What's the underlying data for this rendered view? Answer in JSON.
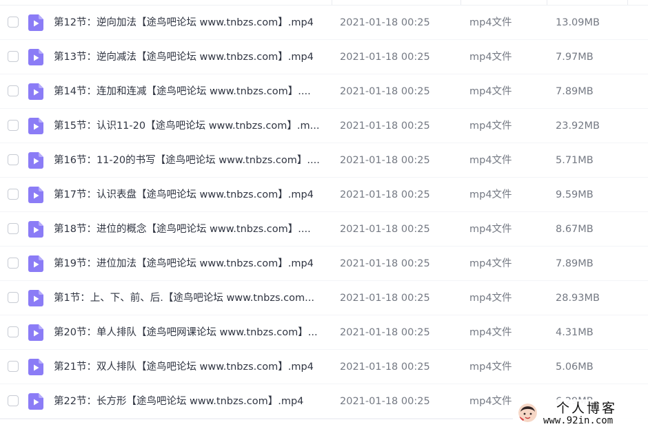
{
  "file_list": {
    "rows": [
      {
        "name": "第12节：逆向加法【途鸟吧论坛 www.tnbzs.com】.mp4",
        "modified": "2021-01-18 00:25",
        "type": "mp4文件",
        "size": "13.09MB"
      },
      {
        "name": "第13节：逆向减法【途鸟吧论坛 www.tnbzs.com】.mp4",
        "modified": "2021-01-18 00:25",
        "type": "mp4文件",
        "size": "7.97MB"
      },
      {
        "name": "第14节：连加和连减【途鸟吧论坛 www.tnbzs.com】....",
        "modified": "2021-01-18 00:25",
        "type": "mp4文件",
        "size": "7.89MB"
      },
      {
        "name": "第15节：认识11-20【途鸟吧论坛 www.tnbzs.com】.m...",
        "modified": "2021-01-18 00:25",
        "type": "mp4文件",
        "size": "23.92MB"
      },
      {
        "name": "第16节：11-20的书写【途鸟吧论坛 www.tnbzs.com】....",
        "modified": "2021-01-18 00:25",
        "type": "mp4文件",
        "size": "5.71MB"
      },
      {
        "name": "第17节：认识表盘【途鸟吧论坛 www.tnbzs.com】.mp4",
        "modified": "2021-01-18 00:25",
        "type": "mp4文件",
        "size": "9.59MB"
      },
      {
        "name": "第18节：进位的概念【途鸟吧论坛 www.tnbzs.com】....",
        "modified": "2021-01-18 00:25",
        "type": "mp4文件",
        "size": "8.67MB"
      },
      {
        "name": "第19节：进位加法【途鸟吧论坛 www.tnbzs.com】.mp4",
        "modified": "2021-01-18 00:25",
        "type": "mp4文件",
        "size": "7.89MB"
      },
      {
        "name": "第1节：上、下、前、后.【途鸟吧论坛 www.tnbzs.com...",
        "modified": "2021-01-18 00:25",
        "type": "mp4文件",
        "size": "28.93MB"
      },
      {
        "name": "第20节：单人排队【途鸟吧网课论坛 www.tnbzs.com】...",
        "modified": "2021-01-18 00:25",
        "type": "mp4文件",
        "size": "4.31MB"
      },
      {
        "name": "第21节：双人排队【途鸟吧论坛 www.tnbzs.com】.mp4",
        "modified": "2021-01-18 00:25",
        "type": "mp4文件",
        "size": "5.06MB"
      },
      {
        "name": "第22节：长方形【途鸟吧论坛 www.tnbzs.com】.mp4",
        "modified": "2021-01-18 00:25",
        "type": "mp4文件",
        "size": "6.29MB"
      }
    ]
  },
  "watermark": {
    "title": "个人博客",
    "url": "www.92in.com"
  },
  "colors": {
    "video_icon": "#8b7cf6",
    "video_icon_fold": "#b6acfb",
    "text_primary": "#2f3441",
    "text_secondary": "#747983"
  }
}
